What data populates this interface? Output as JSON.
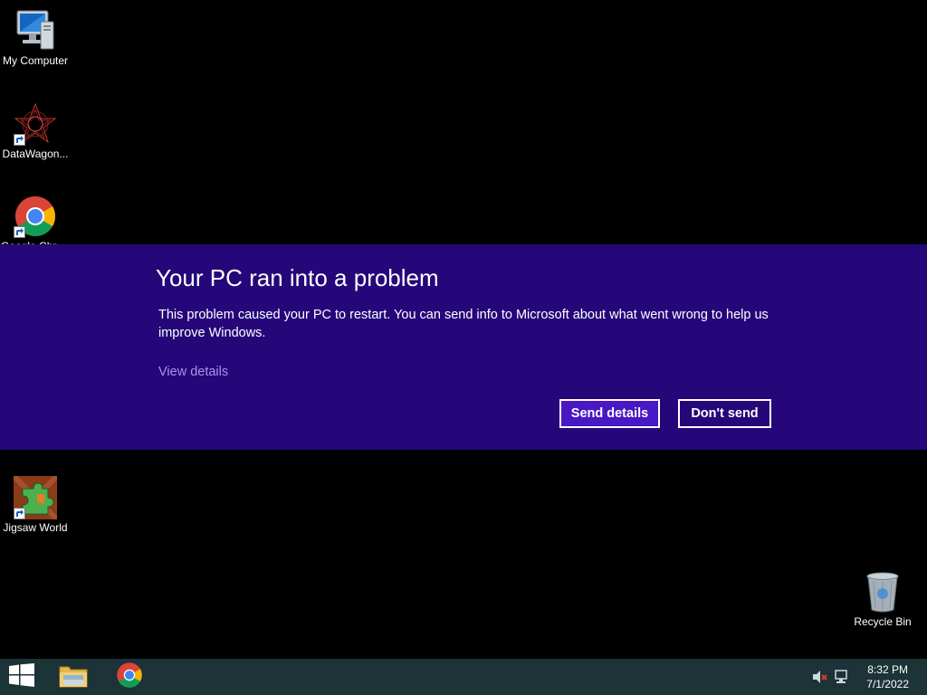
{
  "desktop": {
    "icons": [
      {
        "label": "My Computer",
        "icon": "computer-icon"
      },
      {
        "label": "DataWagon...",
        "icon": "datawagon-icon"
      },
      {
        "label": "Google Chrome",
        "icon": "chrome-icon"
      },
      {
        "label": "Jigsaw World",
        "icon": "jigsaw-icon"
      },
      {
        "label": "Recycle Bin",
        "icon": "recycle-bin-icon"
      }
    ]
  },
  "error_dialog": {
    "title": "Your PC ran into a problem",
    "message": "This problem caused your PC to restart. You can send info to Microsoft about what went wrong to help us improve Windows.",
    "details_link": "View details",
    "send_button": "Send details",
    "dont_send_button": "Don't send",
    "background_color": "#25077a",
    "primary_button_color": "#4a17c4",
    "link_color": "#a695e8"
  },
  "taskbar": {
    "background_color": "#1c3337",
    "items": [
      {
        "icon": "windows-start-icon"
      },
      {
        "icon": "file-explorer-icon"
      },
      {
        "icon": "chrome-icon"
      }
    ],
    "tray": {
      "volume_icon": "volume-muted-icon",
      "network_icon": "network-icon",
      "time": "8:32 PM",
      "date": "7/1/2022"
    }
  }
}
